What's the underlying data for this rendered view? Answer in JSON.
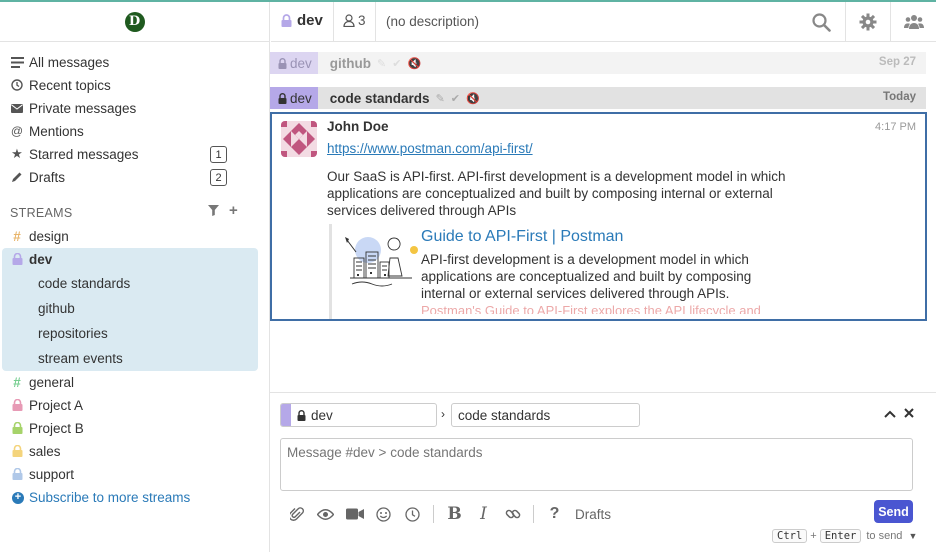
{
  "colors": {
    "accent": "#5fb3a3",
    "link": "#2a7ab8",
    "active_bg": "#daeaf2",
    "send_button": "#4a56d1",
    "selected_border": "#3f6ea6",
    "stream_dev": "#b5a8e8",
    "stream_design": "#e8b56b",
    "stream_general": "#76ce90",
    "stream_project_a": "#e79ab5",
    "stream_project_b": "#a6d36a",
    "stream_sales": "#f4d47c",
    "stream_support": "#b0c8e8"
  },
  "header": {
    "stream_name": "dev",
    "subscriber_count": "3",
    "description": "(no description)",
    "icons": [
      "search-icon",
      "gear-icon",
      "users-icon"
    ]
  },
  "sidebar": {
    "nav": [
      {
        "label": "All messages",
        "icon": "all-messages-icon"
      },
      {
        "label": "Recent topics",
        "icon": "clock-icon"
      },
      {
        "label": "Private messages",
        "icon": "envelope-icon"
      },
      {
        "label": "Mentions",
        "icon": "at-icon"
      },
      {
        "label": "Starred messages",
        "icon": "star-icon",
        "count": "1"
      },
      {
        "label": "Drafts",
        "icon": "pencil-icon",
        "count": "2"
      }
    ],
    "streams_header": "STREAMS",
    "streams": [
      {
        "name": "design",
        "prefix": "#"
      },
      {
        "name": "dev",
        "prefix": "lock",
        "active": true
      },
      {
        "name": "general",
        "prefix": "#"
      },
      {
        "name": "Project A",
        "prefix": "lock"
      },
      {
        "name": "Project B",
        "prefix": "lock"
      },
      {
        "name": "sales",
        "prefix": "lock"
      },
      {
        "name": "support",
        "prefix": "lock"
      }
    ],
    "dev_topics": [
      "code standards",
      "github",
      "repositories",
      "stream events"
    ],
    "subscribe_label": "Subscribe to more streams"
  },
  "messages": {
    "group1": {
      "stream": "dev",
      "topic": "github",
      "date": "Sep 27"
    },
    "group2": {
      "stream": "dev",
      "topic": "code standards",
      "date": "Today"
    },
    "message": {
      "sender": "John Doe",
      "time": "4:17 PM",
      "link": "https://www.postman.com/api-first/",
      "text": "Our SaaS is API-first. API-first development is a development model in which applications are conceptualized and built by composing internal or external services delivered through APIs",
      "preview_title": "Guide to API-First | Postman",
      "preview_description": "API-first development is a development model in which applications are conceptualized and built by composing internal or external services delivered through APIs.",
      "preview_more": "Postman's Guide to API-First explores the API lifecycle and"
    }
  },
  "compose": {
    "stream": "dev",
    "topic": "code standards",
    "placeholder": "Message #dev > code standards",
    "drafts_label": "Drafts",
    "send_label": "Send",
    "kbd_ctrl": "Ctrl",
    "kbd_plus": "+",
    "kbd_enter": "Enter",
    "to_send": "to send",
    "toolbar_icons": [
      "paperclip-icon",
      "eye-icon",
      "video-icon",
      "smile-icon",
      "clock-icon",
      "bold-icon",
      "italic-icon",
      "link-icon",
      "help-icon"
    ]
  }
}
